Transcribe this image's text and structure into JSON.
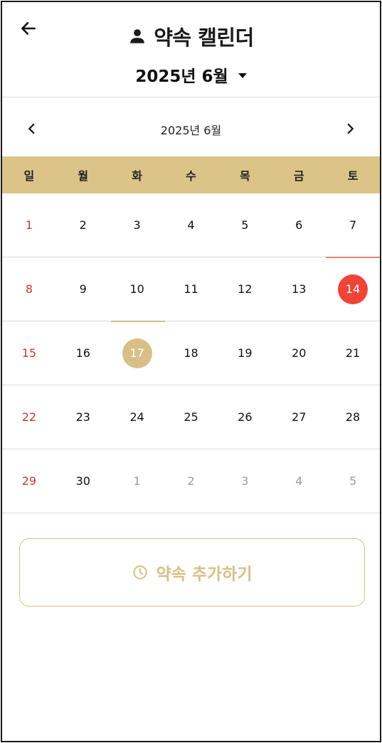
{
  "header": {
    "title": "약속 캘린더",
    "month_select": "2025년 6월"
  },
  "calendar": {
    "nav_label": "2025년 6월",
    "weekdays": [
      "일",
      "월",
      "화",
      "수",
      "목",
      "금",
      "토"
    ],
    "weeks": [
      [
        "1",
        "2",
        "3",
        "4",
        "5",
        "6",
        "7"
      ],
      [
        "8",
        "9",
        "10",
        "11",
        "12",
        "13",
        "14"
      ],
      [
        "15",
        "16",
        "17",
        "18",
        "19",
        "20",
        "21"
      ],
      [
        "22",
        "23",
        "24",
        "25",
        "26",
        "27",
        "28"
      ],
      [
        "29",
        "30",
        "1",
        "2",
        "3",
        "4",
        "5"
      ]
    ],
    "today": "14",
    "selected": "17"
  },
  "add_button": {
    "label": "약속 추가하기"
  },
  "colors": {
    "accent_gold": "#dcc388",
    "today_red": "#f04438",
    "sunday_red": "#c0392b",
    "muted": "#9a9a9a"
  },
  "icons": {
    "back": "arrow-left-icon",
    "title": "person-icon",
    "month_caret": "caret-down-icon",
    "prev": "chevron-left-icon",
    "next": "chevron-right-icon",
    "add": "clock-icon"
  }
}
